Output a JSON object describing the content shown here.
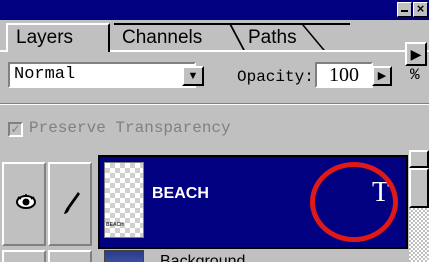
{
  "panel": {
    "tabs": [
      {
        "label": "Layers",
        "active": true
      },
      {
        "label": "Channels",
        "active": false
      },
      {
        "label": "Paths",
        "active": false
      }
    ],
    "blend_mode": "Normal",
    "opacity_label": "Opacity:",
    "opacity_value": "100",
    "percent_sign": "%",
    "preserve_transparency": {
      "label": "Preserve Transparency",
      "checked": true,
      "enabled": false
    },
    "title_buttons": {
      "close": "×"
    }
  },
  "layers": [
    {
      "name": "BEACH",
      "type_icon": "T",
      "thumb_text": "BEACH",
      "selected": true
    },
    {
      "name": "Background",
      "selected": false
    }
  ],
  "annotation": {
    "circle_color": "#e01818"
  },
  "colors": {
    "titlebar": "#000080",
    "selection": "#000080",
    "panel": "#c0c0c0"
  },
  "icons": {
    "eye": "eye-icon",
    "brush": "brush-icon",
    "menu": "triangle-right-icon"
  }
}
